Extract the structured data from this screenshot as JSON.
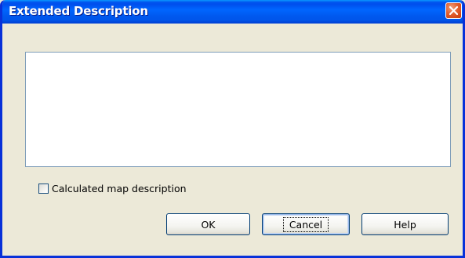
{
  "window": {
    "title": "Extended Description"
  },
  "dialog": {
    "description_value": "",
    "checkbox_label": "Calculated map description",
    "checkbox_checked": false,
    "buttons": {
      "ok": "OK",
      "cancel": "Cancel",
      "help": "Help"
    }
  },
  "icons": {
    "close": "close-icon"
  },
  "colors": {
    "titlebar": "#0055ea",
    "close_button": "#e35f2e",
    "dialog_background": "#ece9d8",
    "field_border": "#7f9db9"
  }
}
